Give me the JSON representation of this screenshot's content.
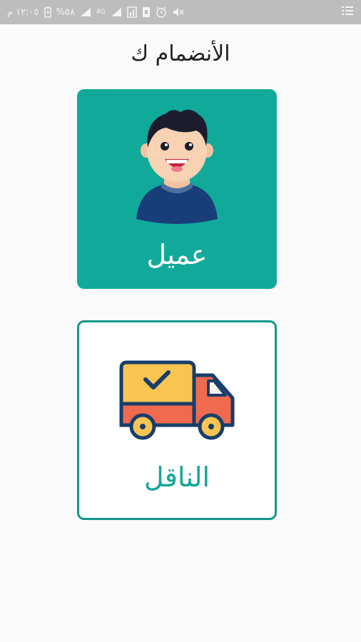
{
  "status_bar": {
    "time": "١٢:٠٥ م",
    "battery": "%٥٨",
    "network": "4G"
  },
  "title": "الأنضمام ك",
  "options": [
    {
      "label": "عميل",
      "icon": "person-avatar-icon"
    },
    {
      "label": "الناقل",
      "icon": "delivery-truck-icon"
    }
  ],
  "colors": {
    "accent": "#11aa9a",
    "border": "#13978a",
    "status_bar": "#bdbdbd"
  }
}
